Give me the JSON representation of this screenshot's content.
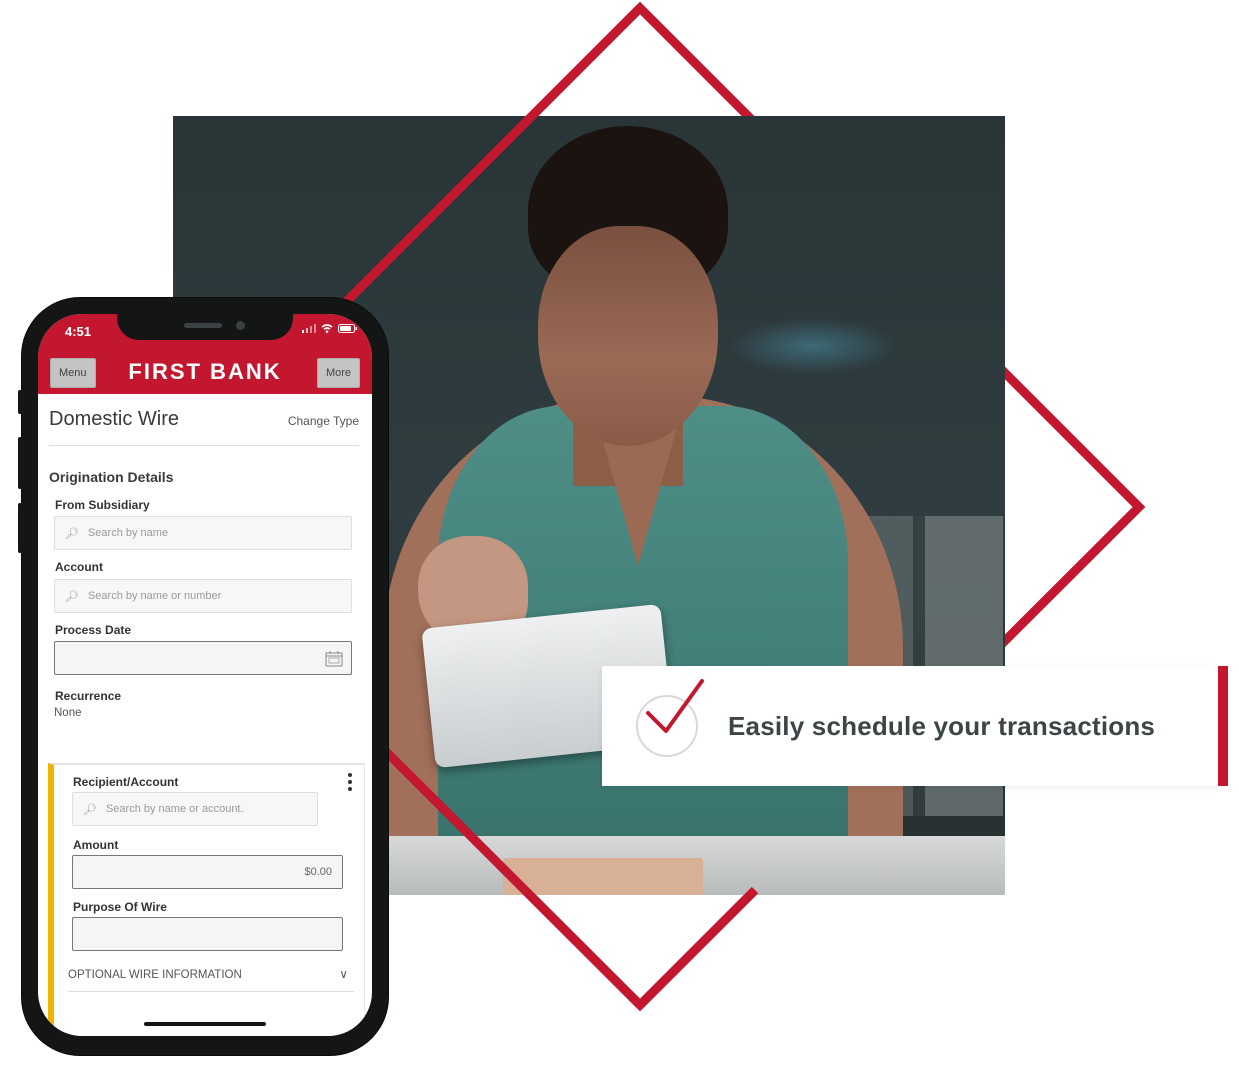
{
  "colors": {
    "brand_red": "#c3172f",
    "accent_yellow": "#f0b400",
    "text_dark": "#3d4547"
  },
  "callout": {
    "icon": "checkmark-circle-icon",
    "text": "Easily schedule your transactions"
  },
  "phone": {
    "status_bar": {
      "time": "4:51",
      "icons": [
        "signal-icon",
        "wifi-icon",
        "battery-icon"
      ]
    },
    "header": {
      "menu_label": "Menu",
      "brand": "FIRST BANK",
      "more_label": "More"
    },
    "page": {
      "title": "Domestic Wire",
      "change_type_label": "Change Type"
    },
    "origination": {
      "section_title": "Origination Details",
      "from_subsidiary": {
        "label": "From Subsidiary",
        "placeholder": "Search by name"
      },
      "account": {
        "label": "Account",
        "placeholder": "Search by name or number"
      },
      "process_date": {
        "label": "Process Date",
        "value": ""
      },
      "recurrence": {
        "label": "Recurrence",
        "value": "None"
      }
    },
    "recipient": {
      "label": "Recipient/Account",
      "placeholder": "Search by name or account.",
      "amount_label": "Amount",
      "amount_value": "$0.00",
      "purpose_label": "Purpose Of Wire",
      "purpose_value": "",
      "optional_section_label": "OPTIONAL WIRE INFORMATION"
    }
  }
}
